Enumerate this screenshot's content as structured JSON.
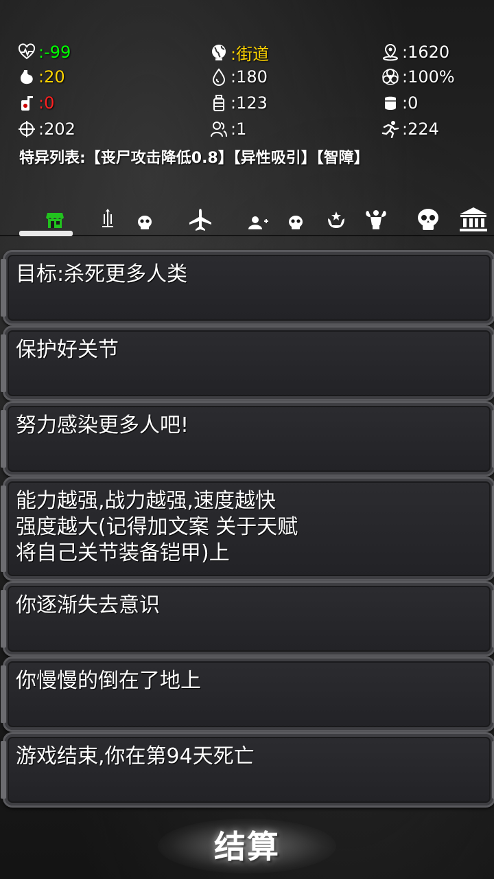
{
  "stats": {
    "health": {
      "value": ":-99",
      "color": "#00ff00",
      "icon": "heartbeat-icon"
    },
    "location": {
      "value": ":街道",
      "color": "#ffd400",
      "icon": "globe-icon"
    },
    "position": {
      "value": ":1620",
      "color": "#ffffff",
      "icon": "map-pin-icon"
    },
    "hunger": {
      "value": ":20",
      "color": "#ffd400",
      "icon": "stomach-icon"
    },
    "water": {
      "value": ":180",
      "color": "#ffffff",
      "icon": "water-drop-icon"
    },
    "infection": {
      "value": ":100%",
      "color": "#ffffff",
      "icon": "biohazard-icon"
    },
    "drink": {
      "value": ":0",
      "color": "#ff2020",
      "icon": "drink-cup-icon"
    },
    "supplies": {
      "value": ":123",
      "color": "#ffffff",
      "icon": "bottle-icon"
    },
    "armor": {
      "value": ":0",
      "color": "#ffffff",
      "icon": "armor-icon"
    },
    "accuracy": {
      "value": ":202",
      "color": "#ffffff",
      "icon": "crosshair-icon"
    },
    "followers": {
      "value": ":1",
      "color": "#ffffff",
      "icon": "group-icon"
    },
    "speed": {
      "value": ":224",
      "color": "#ffffff",
      "icon": "running-icon"
    }
  },
  "traits": "特异列表:【丧尸攻击降低0.8】【异性吸引】【智障】",
  "tabs": [
    {
      "icon": "shop-icon",
      "active": true
    },
    {
      "icon": "weapons-skull-icon"
    },
    {
      "icon": "airplane-icon"
    },
    {
      "icon": "add-person-skull-icon"
    },
    {
      "icon": "power-hand-icon"
    },
    {
      "icon": "muscle-icon"
    },
    {
      "icon": "skull-icon"
    },
    {
      "icon": "bank-icon"
    }
  ],
  "messages": [
    "目标:杀死更多人类",
    "保护好关节",
    "努力感染更多人吧!",
    "能力越强,战力越强,速度越快\n强度越大(记得加文案 关于天赋\n将自己关节装备铠甲)上",
    "你逐渐失去意识",
    "你慢慢的倒在了地上",
    "游戏结束,你在第94天死亡"
  ],
  "settle_label": "结算"
}
